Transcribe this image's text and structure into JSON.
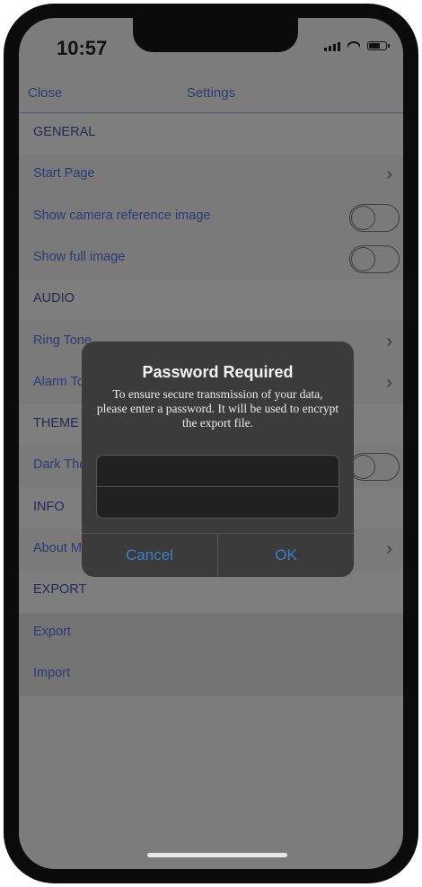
{
  "status": {
    "time": "10:57",
    "battery_level": 0.7
  },
  "navbar": {
    "close": "Close",
    "title": "Settings"
  },
  "settings": [
    {
      "type": "section",
      "label": "GENERAL"
    },
    {
      "type": "link",
      "label": "Start Page"
    },
    {
      "type": "toggle",
      "label": "Show camera reference image",
      "on": false
    },
    {
      "type": "toggle",
      "label": "Show full image",
      "on": false
    },
    {
      "type": "section",
      "label": "AUDIO"
    },
    {
      "type": "link",
      "label": "Ring Tone"
    },
    {
      "type": "link",
      "label": "Alarm Tone"
    },
    {
      "type": "section",
      "label": "THEME"
    },
    {
      "type": "toggle",
      "label": "Dark Theme",
      "on": false
    },
    {
      "type": "section",
      "label": "INFO"
    },
    {
      "type": "link",
      "label": "About Me"
    },
    {
      "type": "section",
      "label": "EXPORT"
    },
    {
      "type": "action",
      "label": "Export"
    },
    {
      "type": "action",
      "label": "Import"
    }
  ],
  "alert": {
    "title": "Password Required",
    "message": "To ensure secure transmission of your data, please enter a password. It will be used to encrypt the export file.",
    "field1_placeholder": "",
    "field2_placeholder": "",
    "cancel": "Cancel",
    "ok": "OK"
  }
}
